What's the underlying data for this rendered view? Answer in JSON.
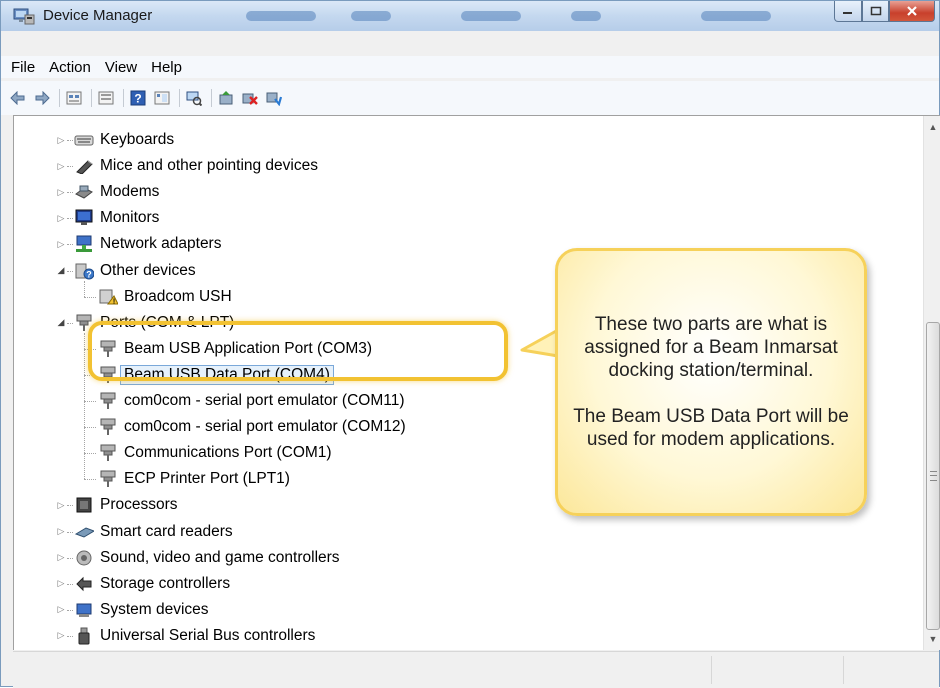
{
  "window": {
    "title": "Device Manager"
  },
  "menu": [
    "File",
    "Action",
    "View",
    "Help"
  ],
  "toolbar": {
    "icons": [
      "back-icon",
      "forward-icon",
      "properties-list-icon",
      "show-hide-icon",
      "help-icon",
      "view-icon",
      "scan-icon",
      "update-driver-icon",
      "uninstall-icon",
      "enable-icon"
    ]
  },
  "tree": [
    {
      "label": "Keyboards",
      "icon": "keyboard-icon"
    },
    {
      "label": "Mice and other pointing devices",
      "icon": "mouse-icon"
    },
    {
      "label": "Modems",
      "icon": "modem-icon"
    },
    {
      "label": "Monitors",
      "icon": "monitor-icon"
    },
    {
      "label": "Network adapters",
      "icon": "network-icon"
    },
    {
      "label": "Other devices",
      "icon": "other-devices-icon"
    },
    {
      "label": "Broadcom USH",
      "icon": "unknown-device-icon"
    },
    {
      "label": "Ports (COM & LPT)",
      "icon": "port-icon"
    },
    {
      "label": "Beam USB Application Port (COM3)",
      "icon": "port-icon"
    },
    {
      "label": "Beam USB Data Port (COM4)",
      "icon": "port-icon"
    },
    {
      "label": "com0com - serial port emulator (COM11)",
      "icon": "port-icon"
    },
    {
      "label": "com0com - serial port emulator (COM12)",
      "icon": "port-icon"
    },
    {
      "label": "Communications Port (COM1)",
      "icon": "port-icon"
    },
    {
      "label": "ECP Printer Port (LPT1)",
      "icon": "port-icon"
    },
    {
      "label": "Processors",
      "icon": "processor-icon"
    },
    {
      "label": "Smart card readers",
      "icon": "smart-card-icon"
    },
    {
      "label": "Sound, video and game controllers",
      "icon": "sound-icon"
    },
    {
      "label": "Storage controllers",
      "icon": "storage-icon"
    },
    {
      "label": "System devices",
      "icon": "system-icon"
    },
    {
      "label": "Universal Serial Bus controllers",
      "icon": "usb-icon"
    }
  ],
  "callout": {
    "line1": "These two parts are what is assigned for a Beam Inmarsat docking station/terminal.",
    "line2": "The Beam USB Data Port will be used for modem applications."
  },
  "colors": {
    "highlight": "#f2c232",
    "callout_border": "#f6d15a",
    "selection": "#e6f1fb"
  }
}
